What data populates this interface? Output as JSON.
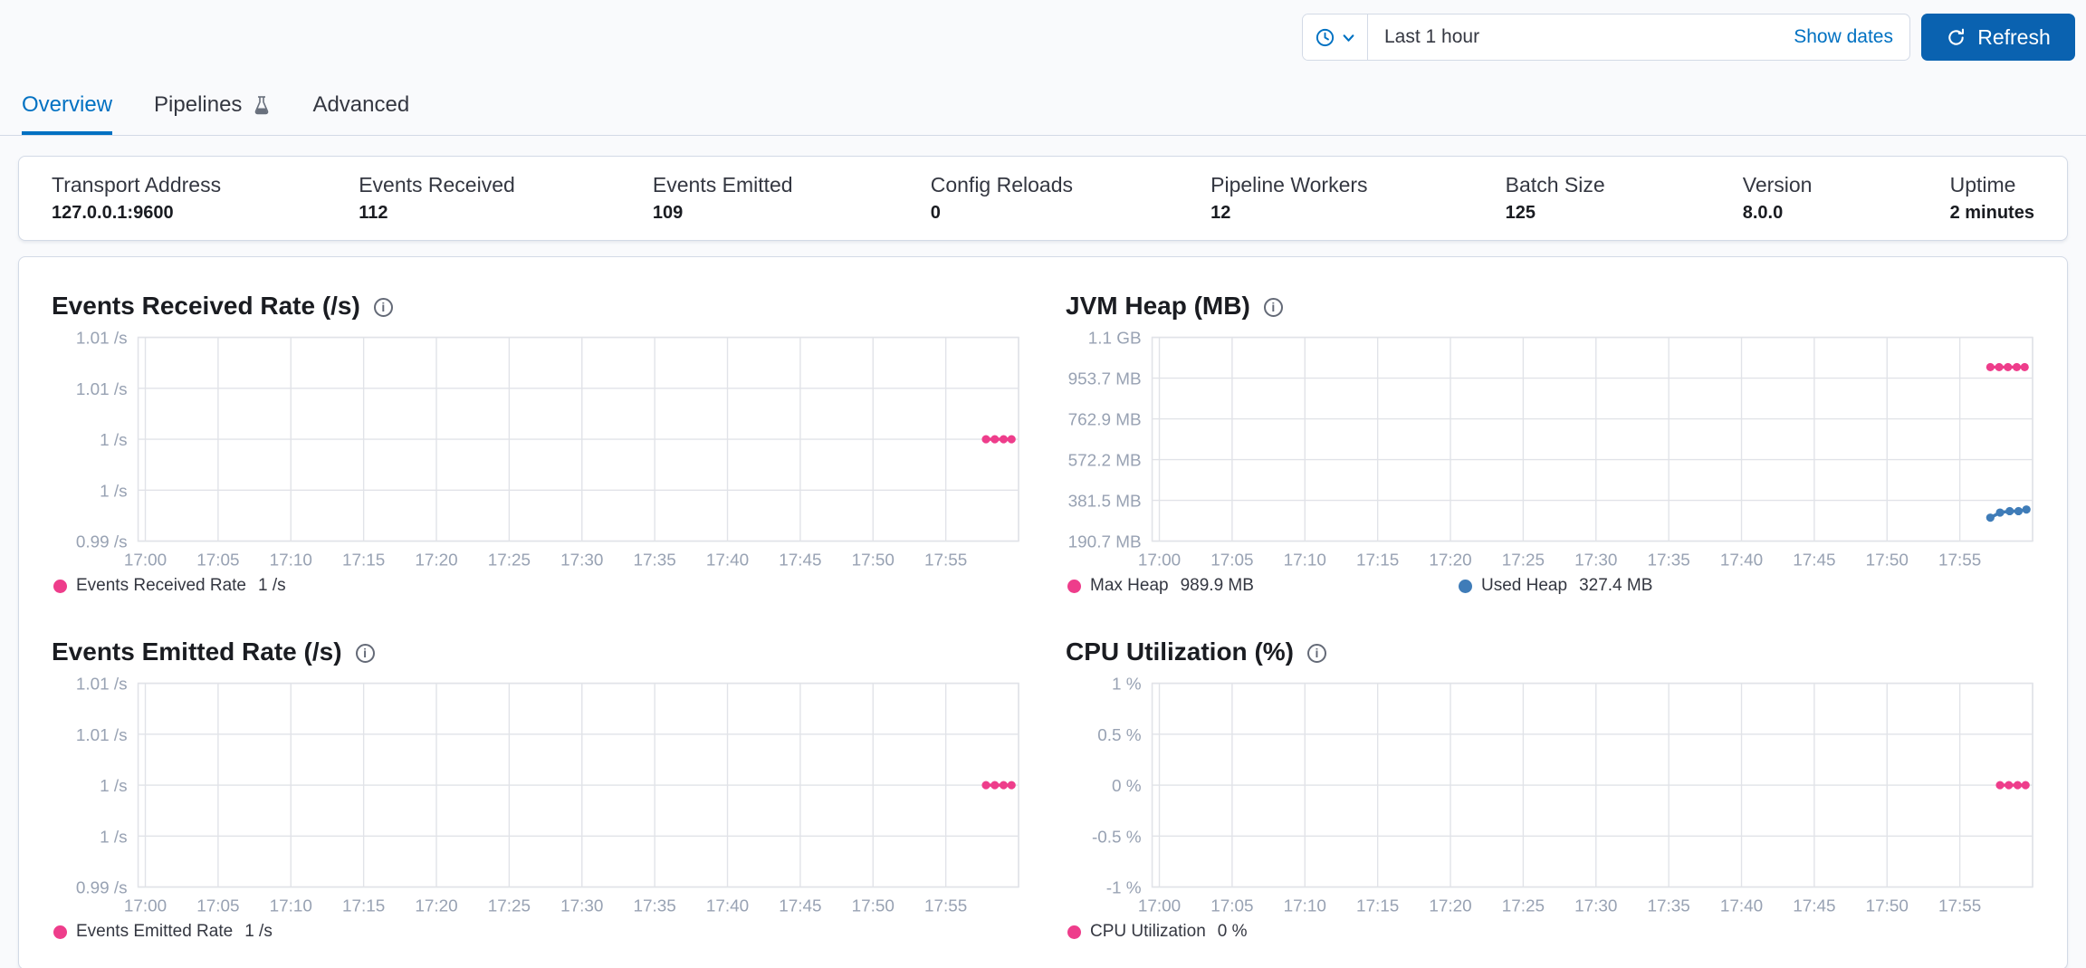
{
  "colors": {
    "primary": "#0071c2",
    "button_fill": "#0a62b0",
    "series_pink": "#ee3d8b",
    "series_blue": "#3f7cb8",
    "grid": "#e1e3e8",
    "axis_text": "#98a2b3",
    "panel_border": "#d3dae6"
  },
  "time_picker": {
    "selected_range": "Last 1 hour",
    "show_dates_label": "Show dates",
    "refresh_label": "Refresh"
  },
  "tabs": [
    {
      "label": "Overview",
      "active": true
    },
    {
      "label": "Pipelines",
      "icon": "beaker-icon",
      "active": false
    },
    {
      "label": "Advanced",
      "active": false
    }
  ],
  "stats": [
    {
      "label": "Transport Address",
      "value": "127.0.0.1:9600"
    },
    {
      "label": "Events Received",
      "value": "112"
    },
    {
      "label": "Events Emitted",
      "value": "109"
    },
    {
      "label": "Config Reloads",
      "value": "0"
    },
    {
      "label": "Pipeline Workers",
      "value": "12"
    },
    {
      "label": "Batch Size",
      "value": "125"
    },
    {
      "label": "Version",
      "value": "8.0.0"
    },
    {
      "label": "Uptime",
      "value": "2 minutes"
    }
  ],
  "charts": [
    {
      "title": "Events Received Rate (/s)",
      "y_ticks": [
        "1.01 /s",
        "1.01 /s",
        "1 /s",
        "1 /s",
        "0.99 /s"
      ],
      "x_ticks": [
        "17:00",
        "17:05",
        "17:10",
        "17:15",
        "17:20",
        "17:25",
        "17:30",
        "17:35",
        "17:40",
        "17:45",
        "17:50",
        "17:55"
      ],
      "legend": [
        {
          "label": "Events Received Rate",
          "value": "1 /s",
          "color": "#ee3d8b"
        }
      ],
      "series": [
        {
          "name": "Events Received Rate",
          "color": "#ee3d8b",
          "points": [
            [
              0.963,
              0.5
            ],
            [
              0.973,
              0.5
            ],
            [
              0.983,
              0.5
            ],
            [
              0.992,
              0.5
            ]
          ]
        }
      ],
      "chart_data": {
        "type": "line",
        "title": "Events Received Rate (/s)",
        "x": [
          "17:52",
          "17:53",
          "17:54",
          "17:55"
        ],
        "series": [
          {
            "name": "Events Received Rate",
            "values": [
              1,
              1,
              1,
              1
            ]
          }
        ],
        "ylabel": "/s",
        "ylim_labels": [
          "0.99 /s",
          "1.01 /s"
        ],
        "x_axis_range": [
          "17:00",
          "17:59"
        ],
        "grid": true,
        "legend_position": "bottom"
      }
    },
    {
      "title": "JVM Heap (MB)",
      "y_ticks": [
        "1.1 GB",
        "953.7 MB",
        "762.9 MB",
        "572.2 MB",
        "381.5 MB",
        "190.7 MB"
      ],
      "x_ticks": [
        "17:00",
        "17:05",
        "17:10",
        "17:15",
        "17:20",
        "17:25",
        "17:30",
        "17:35",
        "17:40",
        "17:45",
        "17:50",
        "17:55"
      ],
      "legend": [
        {
          "label": "Max Heap",
          "value": "989.9 MB",
          "color": "#ee3d8b"
        },
        {
          "label": "Used Heap",
          "value": "327.4 MB",
          "color": "#3f7cb8"
        }
      ],
      "series": [
        {
          "name": "Max Heap",
          "color": "#ee3d8b",
          "points": [
            [
              0.952,
              0.146
            ],
            [
              0.962,
              0.146
            ],
            [
              0.972,
              0.146
            ],
            [
              0.982,
              0.146
            ],
            [
              0.991,
              0.146
            ]
          ]
        },
        {
          "name": "Used Heap",
          "color": "#3f7cb8",
          "points": [
            [
              0.952,
              0.885
            ],
            [
              0.963,
              0.86
            ],
            [
              0.974,
              0.853
            ],
            [
              0.984,
              0.853
            ],
            [
              0.993,
              0.845
            ]
          ]
        }
      ],
      "chart_data": {
        "type": "line",
        "title": "JVM Heap (MB)",
        "x": [
          "17:51",
          "17:52",
          "17:53",
          "17:54",
          "17:55"
        ],
        "series": [
          {
            "name": "Max Heap",
            "values": [
              989.9,
              989.9,
              989.9,
              989.9,
              989.9
            ]
          },
          {
            "name": "Used Heap",
            "values": [
              298,
              322,
              328,
              328,
              327.4
            ]
          }
        ],
        "ylabel": "MB",
        "ylim_labels": [
          "190.7 MB",
          "1.1 GB"
        ],
        "x_axis_range": [
          "17:00",
          "17:59"
        ],
        "grid": true,
        "legend_position": "bottom"
      }
    },
    {
      "title": "Events Emitted Rate (/s)",
      "y_ticks": [
        "1.01 /s",
        "1.01 /s",
        "1 /s",
        "1 /s",
        "0.99 /s"
      ],
      "x_ticks": [
        "17:00",
        "17:05",
        "17:10",
        "17:15",
        "17:20",
        "17:25",
        "17:30",
        "17:35",
        "17:40",
        "17:45",
        "17:50",
        "17:55"
      ],
      "legend": [
        {
          "label": "Events Emitted Rate",
          "value": "1 /s",
          "color": "#ee3d8b"
        }
      ],
      "series": [
        {
          "name": "Events Emitted Rate",
          "color": "#ee3d8b",
          "points": [
            [
              0.963,
              0.5
            ],
            [
              0.973,
              0.5
            ],
            [
              0.983,
              0.5
            ],
            [
              0.992,
              0.5
            ]
          ]
        }
      ],
      "chart_data": {
        "type": "line",
        "title": "Events Emitted Rate (/s)",
        "x": [
          "17:52",
          "17:53",
          "17:54",
          "17:55"
        ],
        "series": [
          {
            "name": "Events Emitted Rate",
            "values": [
              1,
              1,
              1,
              1
            ]
          }
        ],
        "ylabel": "/s",
        "ylim_labels": [
          "0.99 /s",
          "1.01 /s"
        ],
        "x_axis_range": [
          "17:00",
          "17:59"
        ],
        "grid": true,
        "legend_position": "bottom"
      }
    },
    {
      "title": "CPU Utilization (%)",
      "y_ticks": [
        "1 %",
        "0.5 %",
        "0 %",
        "-0.5 %",
        "-1 %"
      ],
      "x_ticks": [
        "17:00",
        "17:05",
        "17:10",
        "17:15",
        "17:20",
        "17:25",
        "17:30",
        "17:35",
        "17:40",
        "17:45",
        "17:50",
        "17:55"
      ],
      "legend": [
        {
          "label": "CPU Utilization",
          "value": "0 %",
          "color": "#ee3d8b"
        }
      ],
      "series": [
        {
          "name": "CPU Utilization",
          "color": "#ee3d8b",
          "points": [
            [
              0.963,
              0.5
            ],
            [
              0.973,
              0.5
            ],
            [
              0.983,
              0.5
            ],
            [
              0.992,
              0.5
            ]
          ]
        }
      ],
      "chart_data": {
        "type": "line",
        "title": "CPU Utilization (%)",
        "x": [
          "17:52",
          "17:53",
          "17:54",
          "17:55"
        ],
        "series": [
          {
            "name": "CPU Utilization",
            "values": [
              0,
              0,
              0,
              0
            ]
          }
        ],
        "ylabel": "%",
        "ylim": [
          -1,
          1
        ],
        "x_axis_range": [
          "17:00",
          "17:59"
        ],
        "grid": true,
        "legend_position": "bottom"
      }
    }
  ]
}
